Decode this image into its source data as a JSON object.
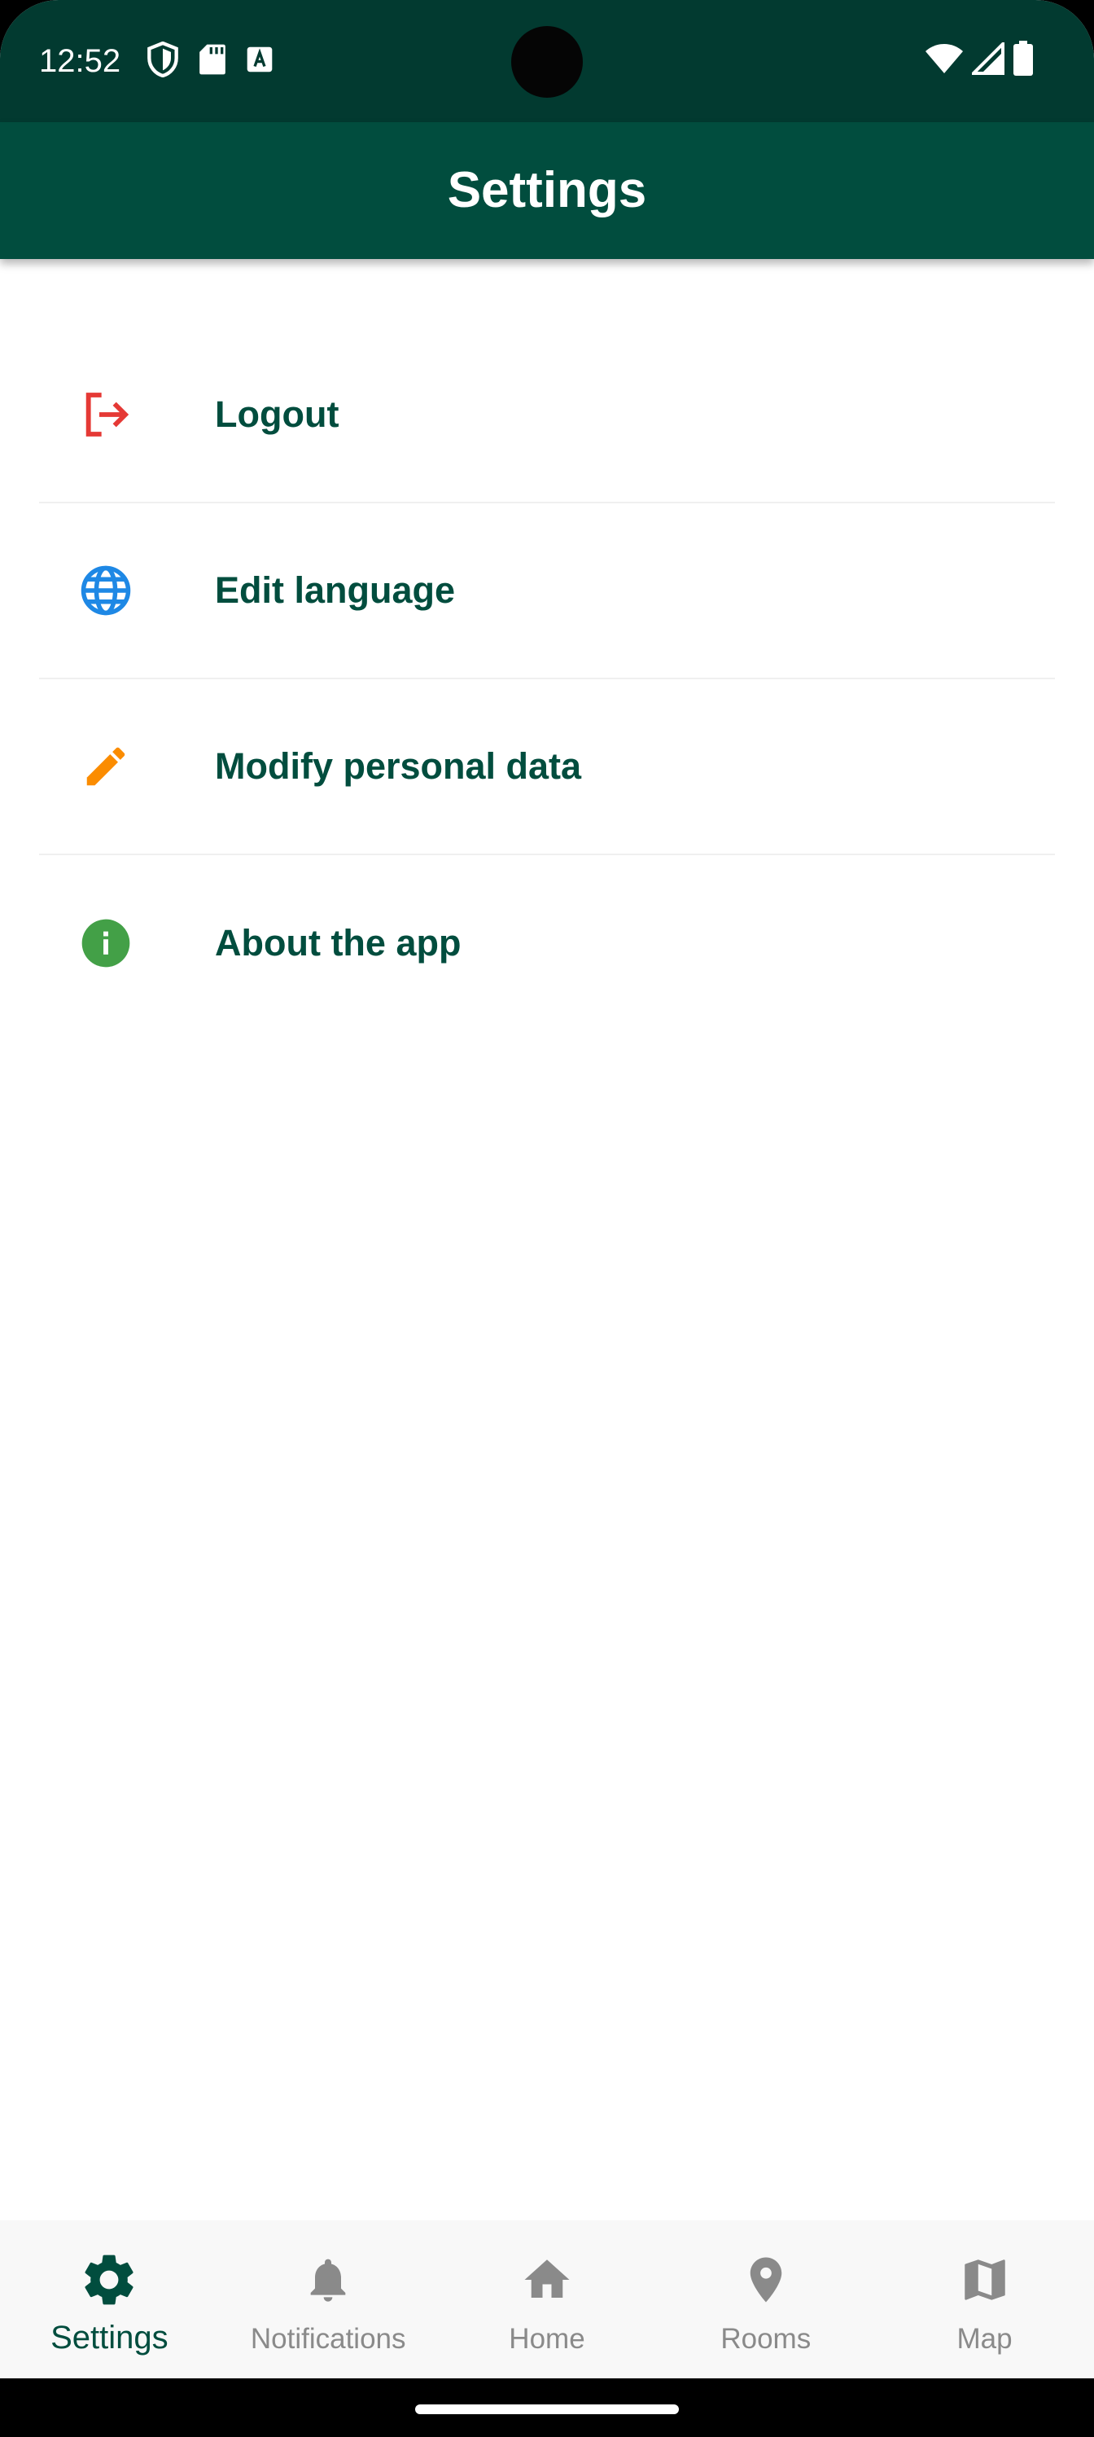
{
  "status_bar": {
    "time": "12:52",
    "left_icons": [
      "shield-icon",
      "sd-card-icon",
      "font-download-icon"
    ],
    "right_icons": [
      "wifi-icon",
      "cell-signal-icon",
      "battery-icon"
    ]
  },
  "app_bar": {
    "title": "Settings",
    "color": "#014d3e"
  },
  "settings": {
    "items": [
      {
        "label": "Logout",
        "icon": "logout-icon",
        "icon_color": "#e53935"
      },
      {
        "label": "Edit language",
        "icon": "globe-icon",
        "icon_color": "#1e88e5"
      },
      {
        "label": "Modify personal data",
        "icon": "pencil-icon",
        "icon_color": "#fb8c00"
      },
      {
        "label": "About the app",
        "icon": "info-icon",
        "icon_color": "#43a047"
      }
    ]
  },
  "bottom_nav": {
    "active": "Settings",
    "items": [
      {
        "label": "Settings",
        "icon": "gear-icon"
      },
      {
        "label": "Notifications",
        "icon": "bell-icon"
      },
      {
        "label": "Home",
        "icon": "home-icon"
      },
      {
        "label": "Rooms",
        "icon": "location-pin-icon"
      },
      {
        "label": "Map",
        "icon": "map-icon"
      }
    ]
  }
}
